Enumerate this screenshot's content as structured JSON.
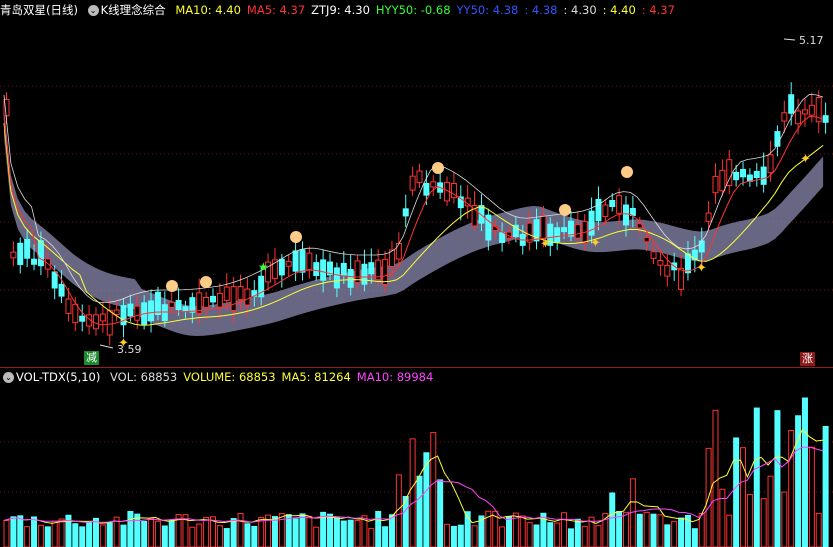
{
  "main_header": {
    "stock_name": "青岛双星",
    "period": "(日线)",
    "indicator_name": "K线理念综合",
    "items": [
      {
        "label": "MA10: 4.40",
        "color": "#ffff33"
      },
      {
        "label": "MA5: 4.37",
        "color": "#ff3333"
      },
      {
        "label": "ZTJ9: 4.30",
        "color": "#ffffff"
      },
      {
        "label": "HYY50: -0.68",
        "color": "#33ff33"
      },
      {
        "label": "YY50: 4.38",
        "color": "#3355ff"
      },
      {
        "label": ": 4.38",
        "color": "#3355ff"
      },
      {
        "label": ": 4.30",
        "color": "#dddddd"
      },
      {
        "label": ": 4.40",
        "color": "#ffff33"
      },
      {
        "label": ": 4.37",
        "color": "#ff3333"
      }
    ]
  },
  "volume_header": {
    "indicator_name": "VOL-TDX(5,10)",
    "items": [
      {
        "label": "VOL: 68853",
        "color": "#dddddd"
      },
      {
        "label": "VOLUME: 68853",
        "color": "#ffff33"
      },
      {
        "label": "MA5: 81264",
        "color": "#ffff33"
      },
      {
        "label": "MA10: 89984",
        "color": "#ff44ff"
      }
    ]
  },
  "markers": {
    "high_price": "5.17",
    "low_price": "3.59",
    "sell_badge": "减",
    "rise_badge": "涨"
  },
  "colors": {
    "up": "#ff3333",
    "down": "#54ffff",
    "ma5": "#ff3333",
    "ma10": "#ffff33",
    "band": "#8a8ab0",
    "vol_ma5": "#ffff33",
    "vol_ma10": "#ff44ff"
  },
  "icons": [
    "butterfly-icon",
    "bell-icon",
    "star-icon"
  ]
}
